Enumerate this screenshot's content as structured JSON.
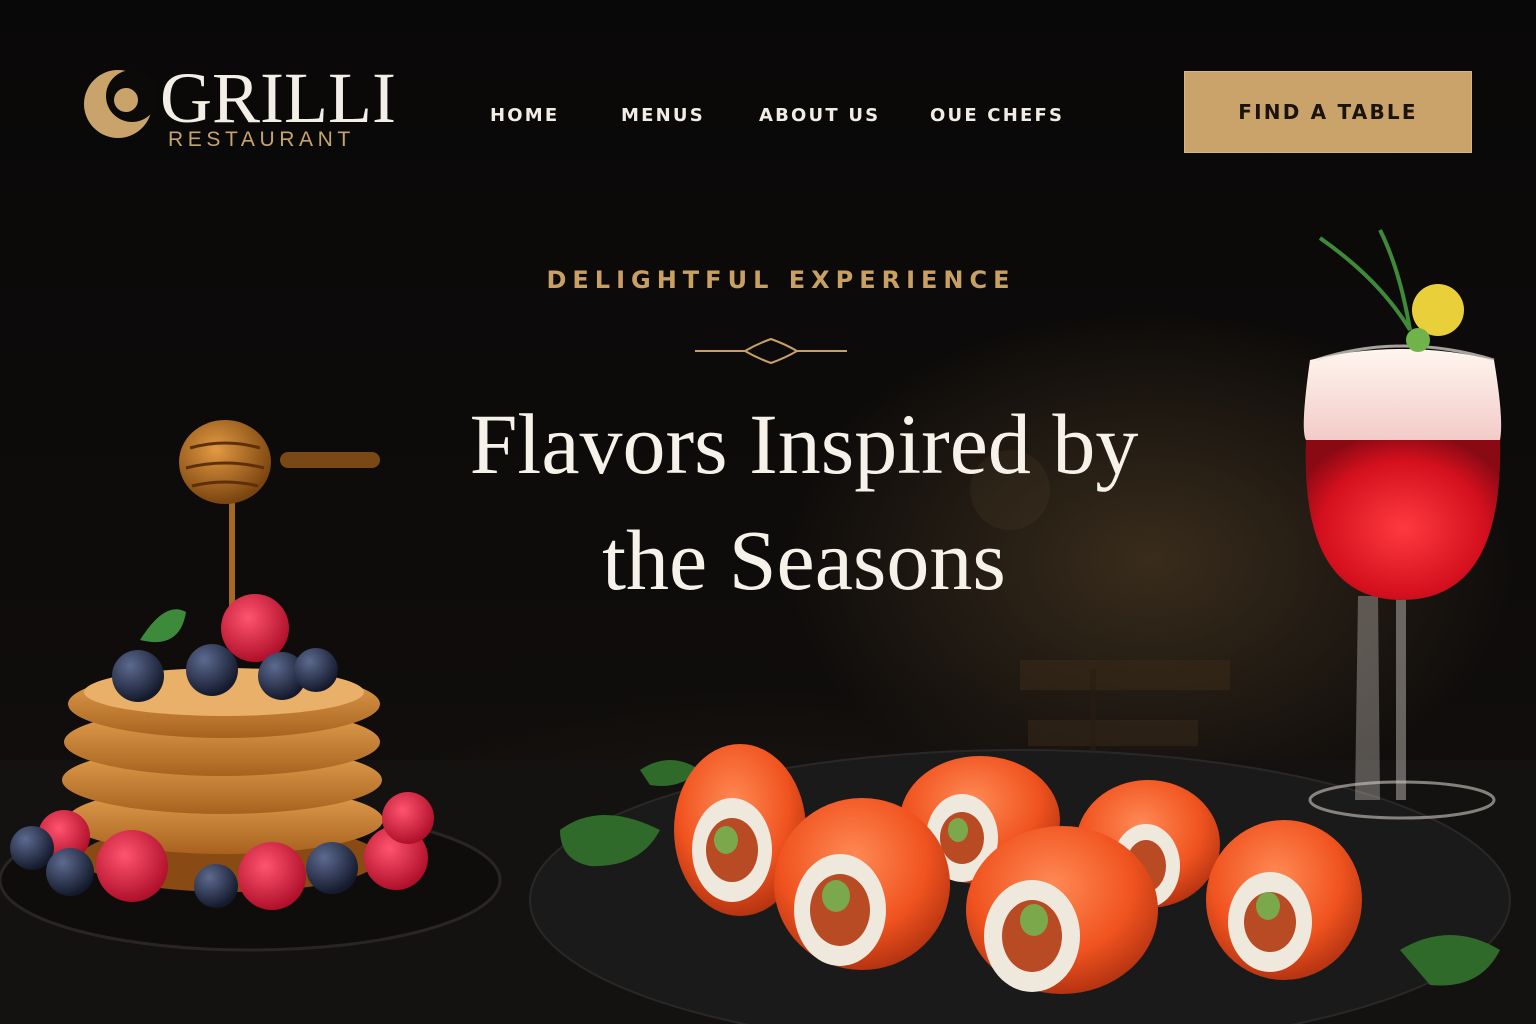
{
  "brand": {
    "name": "GRILLI",
    "subtitle": "RESTAURANT"
  },
  "nav": {
    "items": [
      {
        "label": "HOME"
      },
      {
        "label": "MENUS"
      },
      {
        "label": "ABOUT US"
      },
      {
        "label": "OUE CHEFS"
      }
    ]
  },
  "cta": {
    "label": "FIND A TABLE"
  },
  "hero": {
    "eyebrow": "DELIGHTFUL EXPERIENCE",
    "headline_line1": "Flavors Inspired by",
    "headline_line2": "the Seasons"
  },
  "colors": {
    "accent_gold": "#c9a36a",
    "background": "#0b0a09",
    "headline": "#f6f2ea"
  },
  "icons": {
    "logo_mark": "crescent-logo-icon",
    "divider": "ornament-divider-icon"
  }
}
